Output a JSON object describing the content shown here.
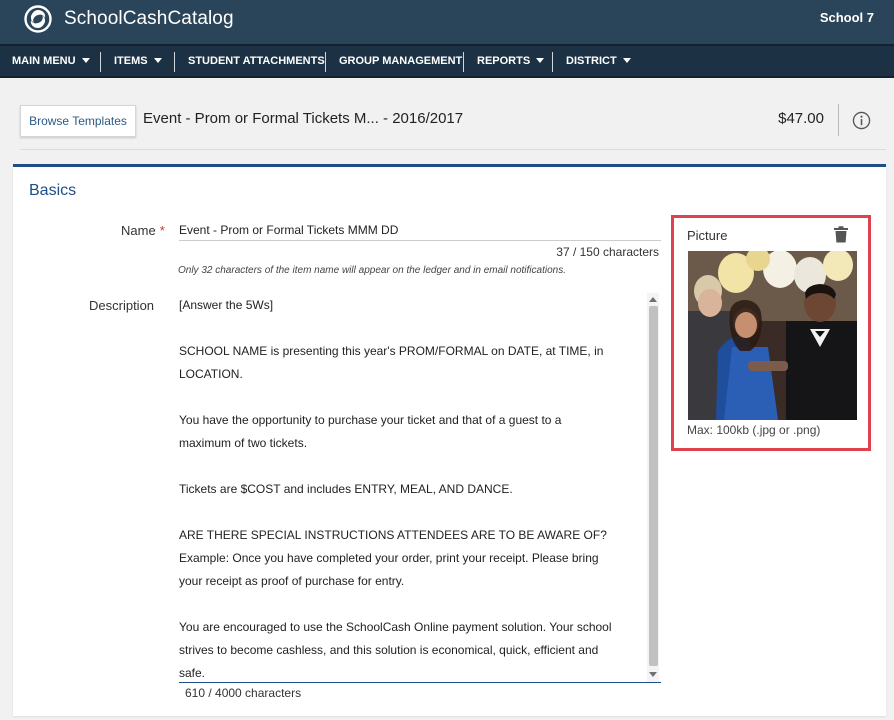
{
  "app": {
    "brand": "SchoolCashCatalog",
    "school": "School 7"
  },
  "nav": [
    {
      "label": "MAIN MENU",
      "dropdown": true
    },
    {
      "label": "ITEMS",
      "dropdown": true
    },
    {
      "label": "STUDENT ATTACHMENTS",
      "dropdown": false
    },
    {
      "label": "GROUP MANAGEMENT",
      "dropdown": false
    },
    {
      "label": "REPORTS",
      "dropdown": true
    },
    {
      "label": "DISTRICT",
      "dropdown": true
    }
  ],
  "header": {
    "browse_label": "Browse Templates",
    "title": "Event - Prom or Formal Tickets M...   - 2016/2017",
    "price": "$47.00"
  },
  "basics": {
    "section_title": "Basics",
    "name_label": "Name",
    "required_mark": "*",
    "name_value": "Event - Prom or Formal Tickets MMM DD",
    "name_count": "37  /  150   characters",
    "name_hint": "Only 32 characters of the item name will appear on the ledger and in email notifications.",
    "description_label": "Description",
    "description_lines": [
      "[Answer the 5Ws]",
      "",
      "SCHOOL NAME is presenting this year's PROM/FORMAL  on DATE, at TIME, in",
      "LOCATION.",
      "",
      "You have the opportunity to purchase your ticket and that of a guest to a",
      "maximum of two tickets.",
      "",
      "Tickets are $COST and includes ENTRY, MEAL, AND DANCE.",
      "",
      "ARE THERE SPECIAL INSTRUCTIONS ATTENDEES ARE TO BE AWARE OF?",
      "Example: Once you have completed your order, print your receipt. Please bring",
      "your receipt as proof of purchase for entry.",
      "",
      "You are encouraged to use the SchoolCash Online payment solution. Your school",
      "strives to become cashless, and this solution is economical, quick, efficient and",
      "safe."
    ],
    "description_count": "610  /  4000   characters"
  },
  "picture": {
    "label": "Picture",
    "hint": "Max: 100kb (.jpg or .png)"
  },
  "colors": {
    "topbar": "#2a4559",
    "navbar": "#1c3244",
    "accent": "#1d4f86",
    "highlight": "#e0414f"
  }
}
